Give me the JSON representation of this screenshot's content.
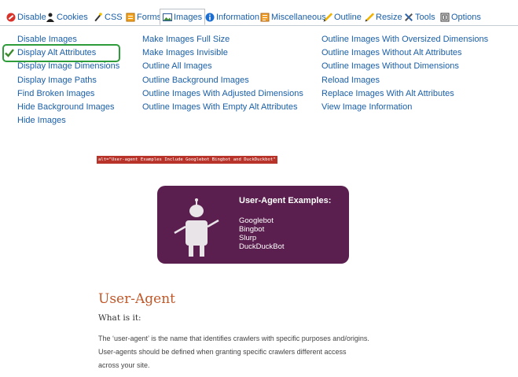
{
  "toolbar": {
    "items": [
      {
        "label": "Disable",
        "icon": "disable-icon"
      },
      {
        "label": "Cookies",
        "icon": "cookies-icon"
      },
      {
        "label": "CSS",
        "icon": "css-wand-icon"
      },
      {
        "label": "Forms",
        "icon": "forms-icon"
      },
      {
        "label": "Images",
        "icon": "images-icon",
        "active": true
      },
      {
        "label": "Information",
        "icon": "information-icon"
      },
      {
        "label": "Miscellaneous",
        "icon": "miscellaneous-icon"
      },
      {
        "label": "Outline",
        "icon": "outline-pencil-icon"
      },
      {
        "label": "Resize",
        "icon": "resize-pencil-icon"
      },
      {
        "label": "Tools",
        "icon": "tools-icon"
      },
      {
        "label": "Options",
        "icon": "options-icon"
      }
    ]
  },
  "menu": {
    "col1": [
      "Disable Images",
      "Display Alt Attributes",
      "Display Image Dimensions",
      "Display Image Paths",
      "Find Broken Images",
      "Hide Background Images",
      "Hide Images"
    ],
    "col2": [
      "Make Images Full Size",
      "Make Images Invisible",
      "Outline All Images",
      "Outline Background Images",
      "Outline Images With Adjusted Dimensions",
      "Outline Images With Empty Alt Attributes"
    ],
    "col3": [
      "Outline Images With Oversized Dimensions",
      "Outline Images Without Alt Attributes",
      "Outline Images Without Dimensions",
      "Reload Images",
      "Replace Images With Alt Attributes",
      "View Image Information"
    ],
    "selected": "Display Alt Attributes"
  },
  "content": {
    "alt_text": "alt=\"User-agent Examples Include Googlebot Bingbot and DuckDuckbot\"",
    "card_title": "User-Agent Examples:",
    "card_items": [
      "Googlebot",
      "Bingbot",
      "Slurp",
      "DuckDuckBot"
    ],
    "heading": "User-Agent",
    "subheading": "What is it:",
    "paragraph_lines": [
      "The ‘user-agent’ is the name that identifies crawlers with specific purposes and/origins.",
      "User-agents should be defined when granting specific crawlers different access",
      "across your site."
    ]
  },
  "colors": {
    "link": "#1a5fa8",
    "selected_border": "#2e9c3a",
    "card_bg": "#5a1f4e",
    "alt_tag_bg": "#b8342a",
    "heading": "#c0582a"
  }
}
